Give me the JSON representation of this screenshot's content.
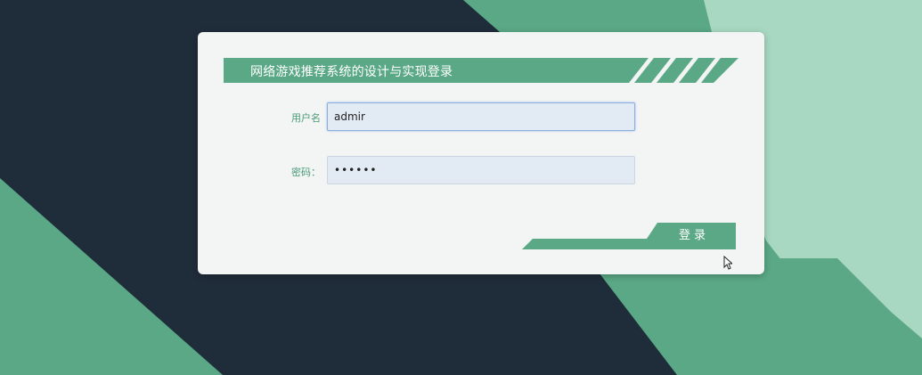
{
  "login": {
    "title": "网络游戏推荐系统的设计与实现登录",
    "username_label": "用户名",
    "username_value": "admir",
    "password_label": "密码：",
    "password_value": "••••••",
    "submit_label": "登录"
  },
  "colors": {
    "accent": "#5aa886",
    "background_dark": "#1f2c3a",
    "background_light_green": "#a8d8c2",
    "card": "#f3f4f4",
    "input_fill": "#e2eaf4",
    "label": "#4a9a78"
  }
}
